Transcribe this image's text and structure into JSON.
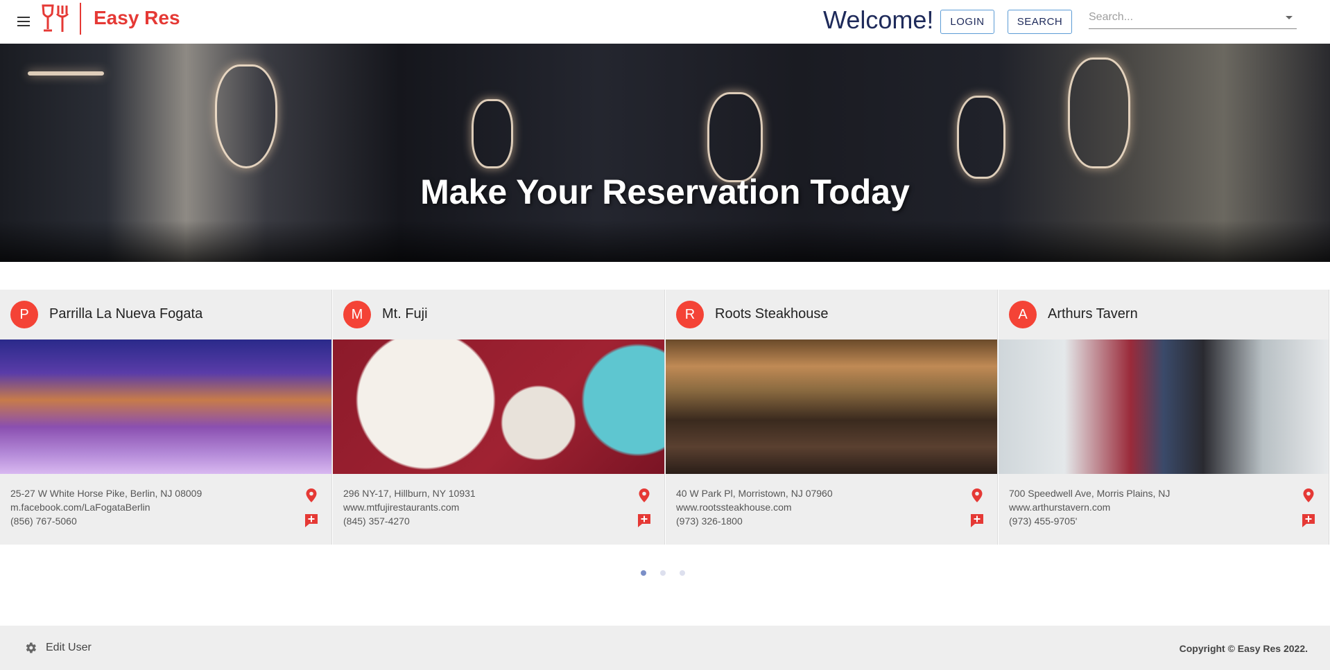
{
  "header": {
    "brand": "Easy Res",
    "welcome": "Welcome!",
    "login_label": "LOGIN",
    "search_label": "SEARCH",
    "search_placeholder": "Search...",
    "menu_icon": "hamburger-menu-icon",
    "logo_icon": "wine-glass-fork-icon",
    "brand_color": "#e53935"
  },
  "hero": {
    "title": "Make Your Reservation Today"
  },
  "restaurants": [
    {
      "initial": "P",
      "name": "Parrilla La Nueva Fogata",
      "address": "25-27 W White Horse Pike, Berlin, NJ 08009",
      "website": "m.facebook.com/LaFogataBerlin",
      "phone": "(856) 767-5060"
    },
    {
      "initial": "M",
      "name": "Mt. Fuji",
      "address": "296 NY-17, Hillburn, NY 10931",
      "website": "www.mtfujirestaurants.com",
      "phone": "(845) 357-4270"
    },
    {
      "initial": "R",
      "name": "Roots Steakhouse",
      "address": "40 W Park Pl, Morristown, NJ 07960",
      "website": "www.rootssteakhouse.com",
      "phone": "(973) 326-1800"
    },
    {
      "initial": "A",
      "name": "Arthurs Tavern",
      "address": "700 Speedwell Ave, Morris Plains, NJ",
      "website": "www.arthurstavern.com",
      "phone": "(973) 455-9705'"
    }
  ],
  "carousel": {
    "page_count": 3,
    "active_page": 1
  },
  "footer": {
    "edit_user": "Edit User",
    "copyright": "Copyright © Easy Res 2022."
  }
}
